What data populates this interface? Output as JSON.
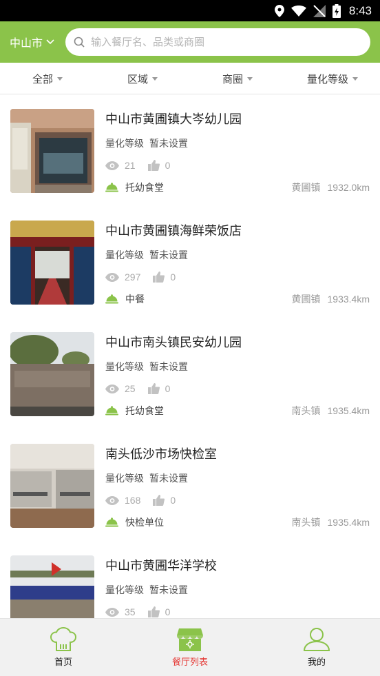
{
  "status_bar": {
    "time": "8:43"
  },
  "header": {
    "city": "中山市",
    "search_placeholder": "输入餐厅名、品类或商圈"
  },
  "filters": [
    "全部",
    "区域",
    "商圈",
    "量化等级"
  ],
  "restaurants": [
    {
      "name": "中山市黄圃镇大岑幼儿园",
      "grade_label": "量化等级",
      "grade_value": "暂未设置",
      "views": "21",
      "likes": "0",
      "category": "托幼食堂",
      "town": "黄圃镇",
      "distance": "1932.0km"
    },
    {
      "name": "中山市黄圃镇海鲜荣饭店",
      "grade_label": "量化等级",
      "grade_value": "暂未设置",
      "views": "297",
      "likes": "0",
      "category": "中餐",
      "town": "黄圃镇",
      "distance": "1933.4km"
    },
    {
      "name": "中山市南头镇民安幼儿园",
      "grade_label": "量化等级",
      "grade_value": "暂未设置",
      "views": "25",
      "likes": "0",
      "category": "托幼食堂",
      "town": "南头镇",
      "distance": "1935.4km"
    },
    {
      "name": "南头低沙市场快检室",
      "grade_label": "量化等级",
      "grade_value": "暂未设置",
      "views": "168",
      "likes": "0",
      "category": "快检单位",
      "town": "南头镇",
      "distance": "1935.4km"
    },
    {
      "name": "中山市黄圃华洋学校",
      "grade_label": "量化等级",
      "grade_value": "暂未设置",
      "views": "35",
      "likes": "0",
      "category": "",
      "town": "",
      "distance": ""
    }
  ],
  "tabs": [
    {
      "label": "首页",
      "icon": "chef-hat-icon",
      "active": false
    },
    {
      "label": "餐厅列表",
      "icon": "storefront-icon",
      "active": true
    },
    {
      "label": "我的",
      "icon": "user-icon",
      "active": false
    }
  ],
  "colors": {
    "brand_green": "#8bc34a",
    "active_tab": "#e53935"
  }
}
